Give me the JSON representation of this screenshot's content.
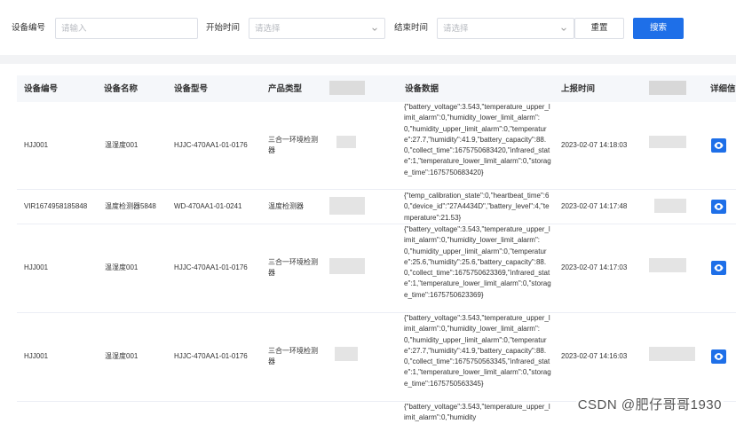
{
  "filters": {
    "device_no_label": "设备编号",
    "device_no_placeholder": "请输入",
    "start_time_label": "开始时间",
    "start_time_placeholder": "请选择",
    "end_time_label": "结束时间",
    "end_time_placeholder": "请选择",
    "reset_label": "重置",
    "search_label": "搜索"
  },
  "table": {
    "headers": {
      "device_no": "设备编号",
      "device_name": "设备名称",
      "device_model": "设备型号",
      "product_type": "产品类型",
      "device_data": "设备数据",
      "report_time": "上报时间",
      "detail": "详细信"
    },
    "rows": [
      {
        "device_no": "HJJ001",
        "device_name": "温湿度001",
        "device_model": "HJJC-470AA1-01-0176",
        "product_type": "三合一环境检测器",
        "device_data": "{\"battery_voltage\":3.543,\"temperature_upper_limit_alarm\":0,\"humidity_lower_limit_alarm\":0,\"humidity_upper_limit_alarm\":0,\"temperature\":27.7,\"humidity\":41.9,\"battery_capacity\":88.0,\"collect_time\":1675750683420,\"infrared_state\":1,\"temperature_lower_limit_alarm\":0,\"storage_time\":1675750683420}",
        "report_time": "2023-02-07 14:18:03"
      },
      {
        "device_no": "VIR1674958185848",
        "device_name": "温度检测器5848",
        "device_model": "WD-470AA1-01-0241",
        "product_type": "温度检测器",
        "device_data": "{\"temp_calibration_state\":0,\"heartbeat_time\":60,\"device_id\":\"27A4434D\",\"battery_level\":4,\"temperature\":21.53}",
        "report_time": "2023-02-07 14:17:48"
      },
      {
        "device_no": "HJJ001",
        "device_name": "温湿度001",
        "device_model": "HJJC-470AA1-01-0176",
        "product_type": "三合一环境检测器",
        "device_data": "{\"battery_voltage\":3.543,\"temperature_upper_limit_alarm\":0,\"humidity_lower_limit_alarm\":0,\"humidity_upper_limit_alarm\":0,\"temperature\":25.6,\"humidity\":25.6,\"battery_capacity\":88.0,\"collect_time\":1675750623369,\"infrared_state\":1,\"temperature_lower_limit_alarm\":0,\"storage_time\":1675750623369}",
        "report_time": "2023-02-07 14:17:03"
      },
      {
        "device_no": "HJJ001",
        "device_name": "温湿度001",
        "device_model": "HJJC-470AA1-01-0176",
        "product_type": "三合一环境检测器",
        "device_data": "{\"battery_voltage\":3.543,\"temperature_upper_limit_alarm\":0,\"humidity_lower_limit_alarm\":0,\"humidity_upper_limit_alarm\":0,\"temperature\":27.7,\"humidity\":41.9,\"battery_capacity\":88.0,\"collect_time\":1675750563345,\"infrared_state\":1,\"temperature_lower_limit_alarm\":0,\"storage_time\":1675750563345}",
        "report_time": "2023-02-07 14:16:03"
      },
      {
        "device_data": "{\"battery_voltage\":3.543,\"temperature_upper_limit_alarm\":0,\"humidity"
      }
    ]
  },
  "watermark": "CSDN @肥仔哥哥1930",
  "colors": {
    "primary": "#1e6fe8",
    "header_bg": "#f5f7fa",
    "border": "#dcdfe6"
  },
  "icons": [
    "chevron-down-icon",
    "eye-icon"
  ]
}
